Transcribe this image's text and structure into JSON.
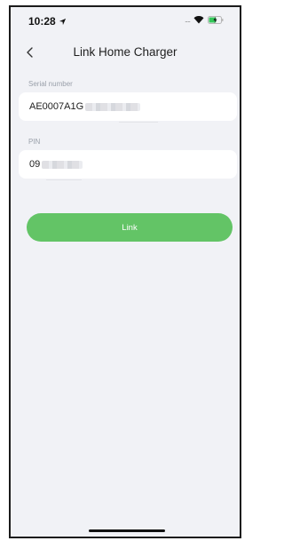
{
  "status_bar": {
    "time": "10:28",
    "icons": [
      "location-arrow-icon",
      "signal-icon",
      "wifi-icon",
      "battery-charging-icon"
    ]
  },
  "nav": {
    "back_icon": "chevron-left-icon",
    "title": "Link Home Charger"
  },
  "form": {
    "serial_label": "Serial number",
    "serial_value": "AE0007A1G",
    "pin_label": "PIN",
    "pin_value": "09"
  },
  "actions": {
    "link_label": "Link"
  },
  "colors": {
    "background": "#f1f2f6",
    "field": "#ffffff",
    "accent_green": "#63c466",
    "battery_green": "#34c759"
  }
}
